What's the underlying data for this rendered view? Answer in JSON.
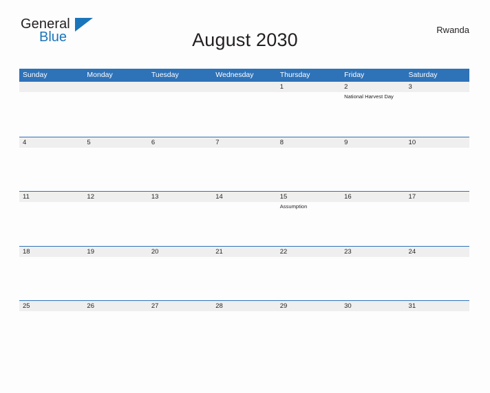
{
  "brand": {
    "name_part1": "General",
    "name_part2": "Blue",
    "flag_icon": "blue-triangle-flag"
  },
  "header": {
    "title": "August 2030",
    "region": "Rwanda"
  },
  "colors": {
    "header_blue": "#2e72b8",
    "brand_blue": "#1b75bb",
    "date_band_gray": "#efefef",
    "page_background": "#fdfdfd",
    "text": "#231f20"
  },
  "calendar": {
    "weekdays": [
      "Sunday",
      "Monday",
      "Tuesday",
      "Wednesday",
      "Thursday",
      "Friday",
      "Saturday"
    ],
    "weeks": [
      {
        "days": [
          {
            "date": "",
            "events": []
          },
          {
            "date": "",
            "events": []
          },
          {
            "date": "",
            "events": []
          },
          {
            "date": "",
            "events": []
          },
          {
            "date": "1",
            "events": []
          },
          {
            "date": "2",
            "events": [
              "National Harvest Day"
            ]
          },
          {
            "date": "3",
            "events": []
          }
        ]
      },
      {
        "days": [
          {
            "date": "4",
            "events": []
          },
          {
            "date": "5",
            "events": []
          },
          {
            "date": "6",
            "events": []
          },
          {
            "date": "7",
            "events": []
          },
          {
            "date": "8",
            "events": []
          },
          {
            "date": "9",
            "events": []
          },
          {
            "date": "10",
            "events": []
          }
        ]
      },
      {
        "days": [
          {
            "date": "11",
            "events": []
          },
          {
            "date": "12",
            "events": []
          },
          {
            "date": "13",
            "events": []
          },
          {
            "date": "14",
            "events": []
          },
          {
            "date": "15",
            "events": [
              "Assumption"
            ]
          },
          {
            "date": "16",
            "events": []
          },
          {
            "date": "17",
            "events": []
          }
        ]
      },
      {
        "days": [
          {
            "date": "18",
            "events": []
          },
          {
            "date": "19",
            "events": []
          },
          {
            "date": "20",
            "events": []
          },
          {
            "date": "21",
            "events": []
          },
          {
            "date": "22",
            "events": []
          },
          {
            "date": "23",
            "events": []
          },
          {
            "date": "24",
            "events": []
          }
        ]
      },
      {
        "days": [
          {
            "date": "25",
            "events": []
          },
          {
            "date": "26",
            "events": []
          },
          {
            "date": "27",
            "events": []
          },
          {
            "date": "28",
            "events": []
          },
          {
            "date": "29",
            "events": []
          },
          {
            "date": "30",
            "events": []
          },
          {
            "date": "31",
            "events": []
          }
        ]
      }
    ]
  }
}
